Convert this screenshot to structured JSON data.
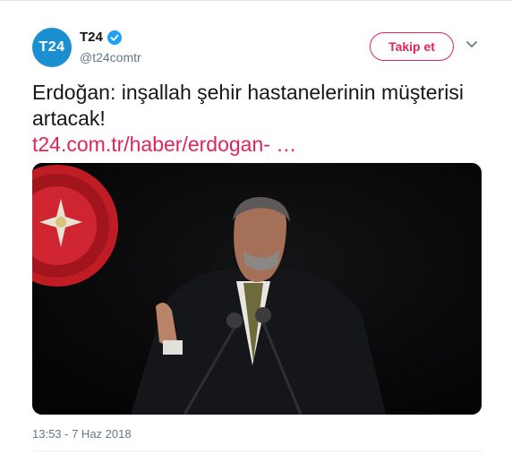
{
  "account": {
    "name": "T24",
    "handle": "@t24comtr",
    "avatar_text": "T24",
    "verified_icon": "verified-badge-icon"
  },
  "actions": {
    "follow_label": "Takip et",
    "more_icon": "chevron-down-icon"
  },
  "tweet": {
    "text": "Erdoğan: inşallah şehir hastanelerinin müşterisi artacak!",
    "link": "t24.com.tr/haber/erdogan-  …",
    "timestamp": "13:53 - 7 Haz 2018"
  },
  "colors": {
    "brand_blue": "#1c8fd0",
    "accent_pink": "#e0245e",
    "secondary_text": "#657786",
    "verified_blue": "#1da1f2"
  }
}
